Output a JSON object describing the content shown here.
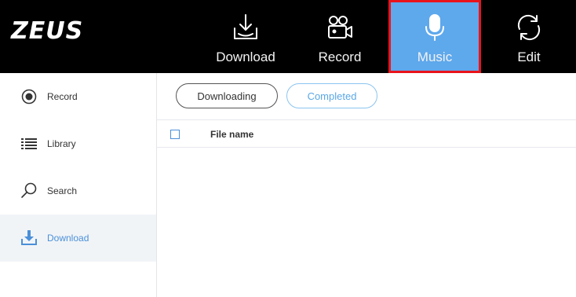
{
  "app": {
    "logo": "ZEUS"
  },
  "tabs": [
    {
      "label": "Download",
      "icon": "download-tray-icon"
    },
    {
      "label": "Record",
      "icon": "video-camera-icon"
    },
    {
      "label": "Music",
      "icon": "microphone-icon",
      "active": true
    },
    {
      "label": "Edit",
      "icon": "refresh-cycle-icon"
    }
  ],
  "sidebar": {
    "items": [
      {
        "label": "Record",
        "icon": "record-icon"
      },
      {
        "label": "Library",
        "icon": "list-icon"
      },
      {
        "label": "Search",
        "icon": "search-icon"
      },
      {
        "label": "Download",
        "icon": "download-icon",
        "active": true
      }
    ]
  },
  "main": {
    "filters": {
      "downloading": "Downloading",
      "completed": "Completed"
    },
    "table": {
      "columns": [
        "File name"
      ]
    }
  },
  "colors": {
    "accent": "#5ea8ec",
    "highlight_border": "#e8141b",
    "topbar": "#000000"
  }
}
